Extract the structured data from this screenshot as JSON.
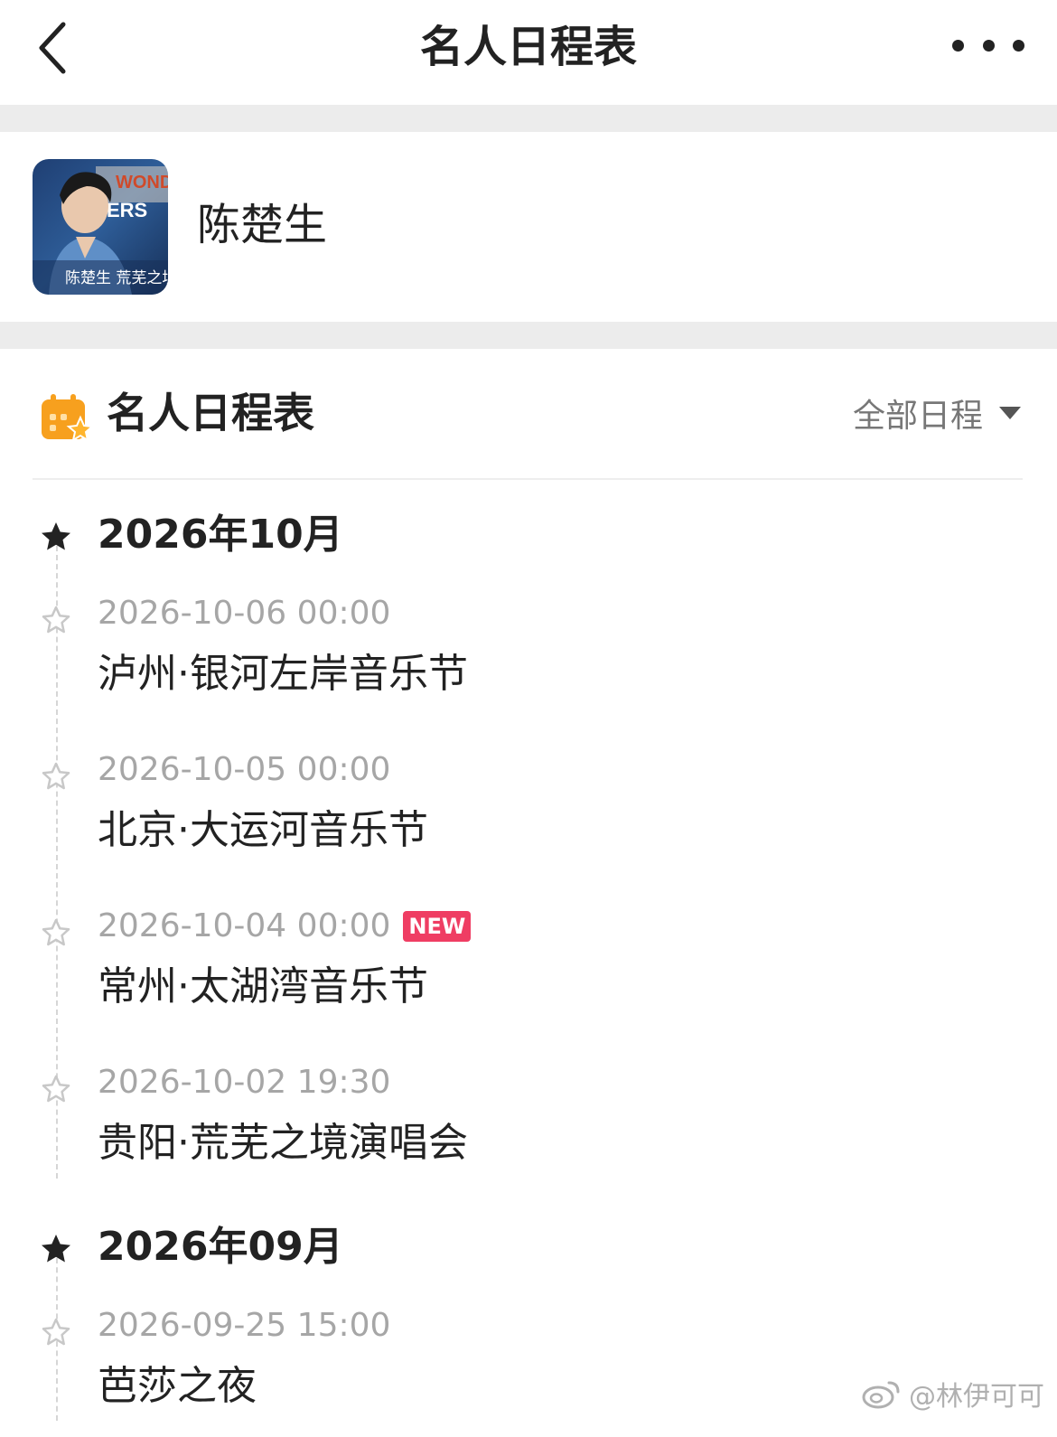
{
  "nav": {
    "title": "名人日程表"
  },
  "profile": {
    "name": "陈楚生",
    "avatar_text": {
      "top": "WONDERLAND",
      "mid": "ERS",
      "bottom": "陈楚生 荒芜之境"
    }
  },
  "section": {
    "title": "名人日程表",
    "filter_label": "全部日程"
  },
  "months": [
    {
      "label": "2026年10月",
      "events": [
        {
          "time": "2026-10-06 00:00",
          "title": "泸州·银河左岸音乐节",
          "badge": ""
        },
        {
          "time": "2026-10-05 00:00",
          "title": "北京·大运河音乐节",
          "badge": ""
        },
        {
          "time": "2026-10-04 00:00",
          "title": "常州·太湖湾音乐节",
          "badge": "NEW"
        },
        {
          "time": "2026-10-02 19:30",
          "title": "贵阳·荒芜之境演唱会",
          "badge": ""
        }
      ]
    },
    {
      "label": "2026年09月",
      "events": [
        {
          "time": "2026-09-25 15:00",
          "title": "芭莎之夜",
          "badge": ""
        }
      ]
    }
  ],
  "watermark": "@林伊可可",
  "colors": {
    "accent_orange": "#f7a01e",
    "badge_red": "#ef3d63",
    "gap_gray": "#ececec"
  }
}
